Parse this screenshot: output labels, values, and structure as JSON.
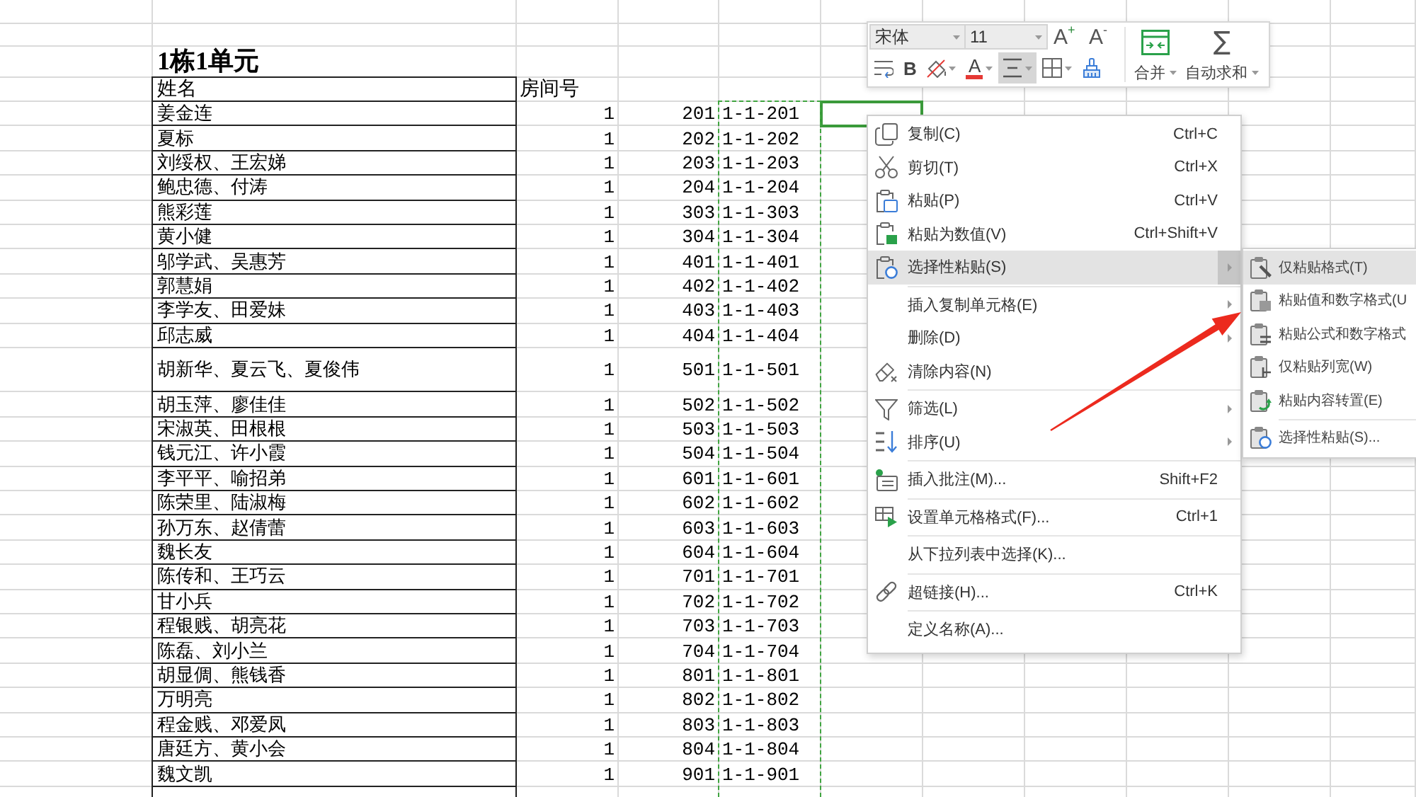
{
  "sheet": {
    "title": "1栋1单元",
    "columns": [
      "姓名",
      "房间号"
    ],
    "code_column_copied": true,
    "rows": [
      {
        "name": "姜金连",
        "building": "1",
        "room": "201",
        "code": "1-1-201",
        "tall": false,
        "selected": true
      },
      {
        "name": "夏标",
        "building": "1",
        "room": "202",
        "code": "1-1-202",
        "tall": false,
        "selected": false
      },
      {
        "name": "刘绥权、王宏娣",
        "building": "1",
        "room": "203",
        "code": "1-1-203",
        "tall": false,
        "selected": false
      },
      {
        "name": "鲍忠德、付涛",
        "building": "1",
        "room": "204",
        "code": "1-1-204",
        "tall": false,
        "selected": false
      },
      {
        "name": "熊彩莲",
        "building": "1",
        "room": "303",
        "code": "1-1-303",
        "tall": false,
        "selected": false
      },
      {
        "name": "黄小健",
        "building": "1",
        "room": "304",
        "code": "1-1-304",
        "tall": false,
        "selected": false
      },
      {
        "name": "邬学武、吴惠芳",
        "building": "1",
        "room": "401",
        "code": "1-1-401",
        "tall": false,
        "selected": false
      },
      {
        "name": "郭慧娟",
        "building": "1",
        "room": "402",
        "code": "1-1-402",
        "tall": false,
        "selected": false
      },
      {
        "name": "李学友、田爱妹",
        "building": "1",
        "room": "403",
        "code": "1-1-403",
        "tall": false,
        "selected": false
      },
      {
        "name": "邱志威",
        "building": "1",
        "room": "404",
        "code": "1-1-404",
        "tall": false,
        "selected": false
      },
      {
        "name": "胡新华、夏云飞、夏俊伟",
        "building": "1",
        "room": "501",
        "code": "1-1-501",
        "tall": true,
        "selected": false
      },
      {
        "name": "胡玉萍、廖佳佳",
        "building": "1",
        "room": "502",
        "code": "1-1-502",
        "tall": false,
        "selected": false
      },
      {
        "name": "宋淑英、田根根",
        "building": "1",
        "room": "503",
        "code": "1-1-503",
        "tall": false,
        "selected": false
      },
      {
        "name": "钱元江、许小霞",
        "building": "1",
        "room": "504",
        "code": "1-1-504",
        "tall": false,
        "selected": false
      },
      {
        "name": "李平平、喻招弟",
        "building": "1",
        "room": "601",
        "code": "1-1-601",
        "tall": false,
        "selected": false
      },
      {
        "name": "陈荣里、陆淑梅",
        "building": "1",
        "room": "602",
        "code": "1-1-602",
        "tall": false,
        "selected": false
      },
      {
        "name": "孙万东、赵倩蕾",
        "building": "1",
        "room": "603",
        "code": "1-1-603",
        "tall": false,
        "selected": false
      },
      {
        "name": "魏长友",
        "building": "1",
        "room": "604",
        "code": "1-1-604",
        "tall": false,
        "selected": false
      },
      {
        "name": "陈传和、王巧云",
        "building": "1",
        "room": "701",
        "code": "1-1-701",
        "tall": false,
        "selected": false
      },
      {
        "name": "甘小兵",
        "building": "1",
        "room": "702",
        "code": "1-1-702",
        "tall": false,
        "selected": false
      },
      {
        "name": "程银贱、胡亮花",
        "building": "1",
        "room": "703",
        "code": "1-1-703",
        "tall": false,
        "selected": false
      },
      {
        "name": "陈磊、刘小兰",
        "building": "1",
        "room": "704",
        "code": "1-1-704",
        "tall": false,
        "selected": false
      },
      {
        "name": "胡显倜、熊钱香",
        "building": "1",
        "room": "801",
        "code": "1-1-801",
        "tall": false,
        "selected": false
      },
      {
        "name": "万明亮",
        "building": "1",
        "room": "802",
        "code": "1-1-802",
        "tall": false,
        "selected": false
      },
      {
        "name": "程金贱、邓爱凤",
        "building": "1",
        "room": "803",
        "code": "1-1-803",
        "tall": false,
        "selected": false
      },
      {
        "name": "唐廷方、黄小会",
        "building": "1",
        "room": "804",
        "code": "1-1-804",
        "tall": false,
        "selected": false
      },
      {
        "name": "魏文凯",
        "building": "1",
        "room": "901",
        "code": "1-1-901",
        "tall": false,
        "selected": false
      }
    ]
  },
  "mini_toolbar": {
    "font_name": "宋体",
    "font_size": "11",
    "size_buttons": [
      {
        "kind": "grow",
        "label": "A",
        "sign": "+"
      },
      {
        "kind": "shrink",
        "label": "A",
        "sign": "-"
      }
    ],
    "format_buttons": [
      {
        "kind": "wrap",
        "on": false
      },
      {
        "kind": "bold",
        "label": "B",
        "on": false
      },
      {
        "kind": "fill",
        "on": false
      },
      {
        "kind": "font_color",
        "label": "A",
        "on": false
      },
      {
        "kind": "align",
        "on": true
      },
      {
        "kind": "borders",
        "on": false
      },
      {
        "kind": "painter",
        "on": false
      }
    ],
    "merge": {
      "label": "合并"
    },
    "autosum": {
      "symbol": "∑",
      "label": "自动求和"
    }
  },
  "context_menu": {
    "groups": [
      [
        {
          "label": "复制(C)",
          "shortcut": "Ctrl+C",
          "has_submenu": false,
          "selected": false
        },
        {
          "label": "剪切(T)",
          "shortcut": "Ctrl+X",
          "has_submenu": false,
          "selected": false
        },
        {
          "label": "粘贴(P)",
          "shortcut": "Ctrl+V",
          "has_submenu": false,
          "selected": false
        },
        {
          "label": "粘贴为数值(V)",
          "shortcut": "Ctrl+Shift+V",
          "has_submenu": false,
          "selected": false
        },
        {
          "label": "选择性粘贴(S)",
          "has_submenu": true,
          "selected": true
        }
      ],
      [
        {
          "label": "插入复制单元格(E)",
          "has_submenu": true,
          "selected": false
        },
        {
          "label": "删除(D)",
          "has_submenu": true,
          "selected": false
        },
        {
          "label": "清除内容(N)",
          "has_submenu": false,
          "selected": false
        }
      ],
      [
        {
          "label": "筛选(L)",
          "has_submenu": true,
          "selected": false
        },
        {
          "label": "排序(U)",
          "has_submenu": true,
          "selected": false
        }
      ],
      [
        {
          "label": "插入批注(M)...",
          "shortcut": "Shift+F2",
          "has_submenu": false,
          "selected": false
        }
      ],
      [
        {
          "label": "设置单元格格式(F)...",
          "shortcut": "Ctrl+1",
          "has_submenu": false,
          "selected": false
        }
      ],
      [
        {
          "label": "从下拉列表中选择(K)...",
          "has_submenu": false,
          "selected": false
        }
      ],
      [
        {
          "label": "超链接(H)...",
          "shortcut": "Ctrl+K",
          "has_submenu": false,
          "selected": false
        }
      ],
      [
        {
          "label": "定义名称(A)...",
          "has_submenu": false,
          "selected": false
        }
      ]
    ]
  },
  "submenu": {
    "groups": [
      [
        {
          "label": "仅粘贴格式(T)",
          "selected": true
        },
        {
          "label": "粘贴值和数字格式(U",
          "selected": false
        },
        {
          "label": "粘贴公式和数字格式",
          "selected": false
        },
        {
          "label": "仅粘贴列宽(W)",
          "selected": false
        },
        {
          "label": "粘贴内容转置(E)",
          "selected": false
        }
      ],
      [
        {
          "label": "选择性粘贴(S)...",
          "selected": false
        }
      ]
    ]
  }
}
